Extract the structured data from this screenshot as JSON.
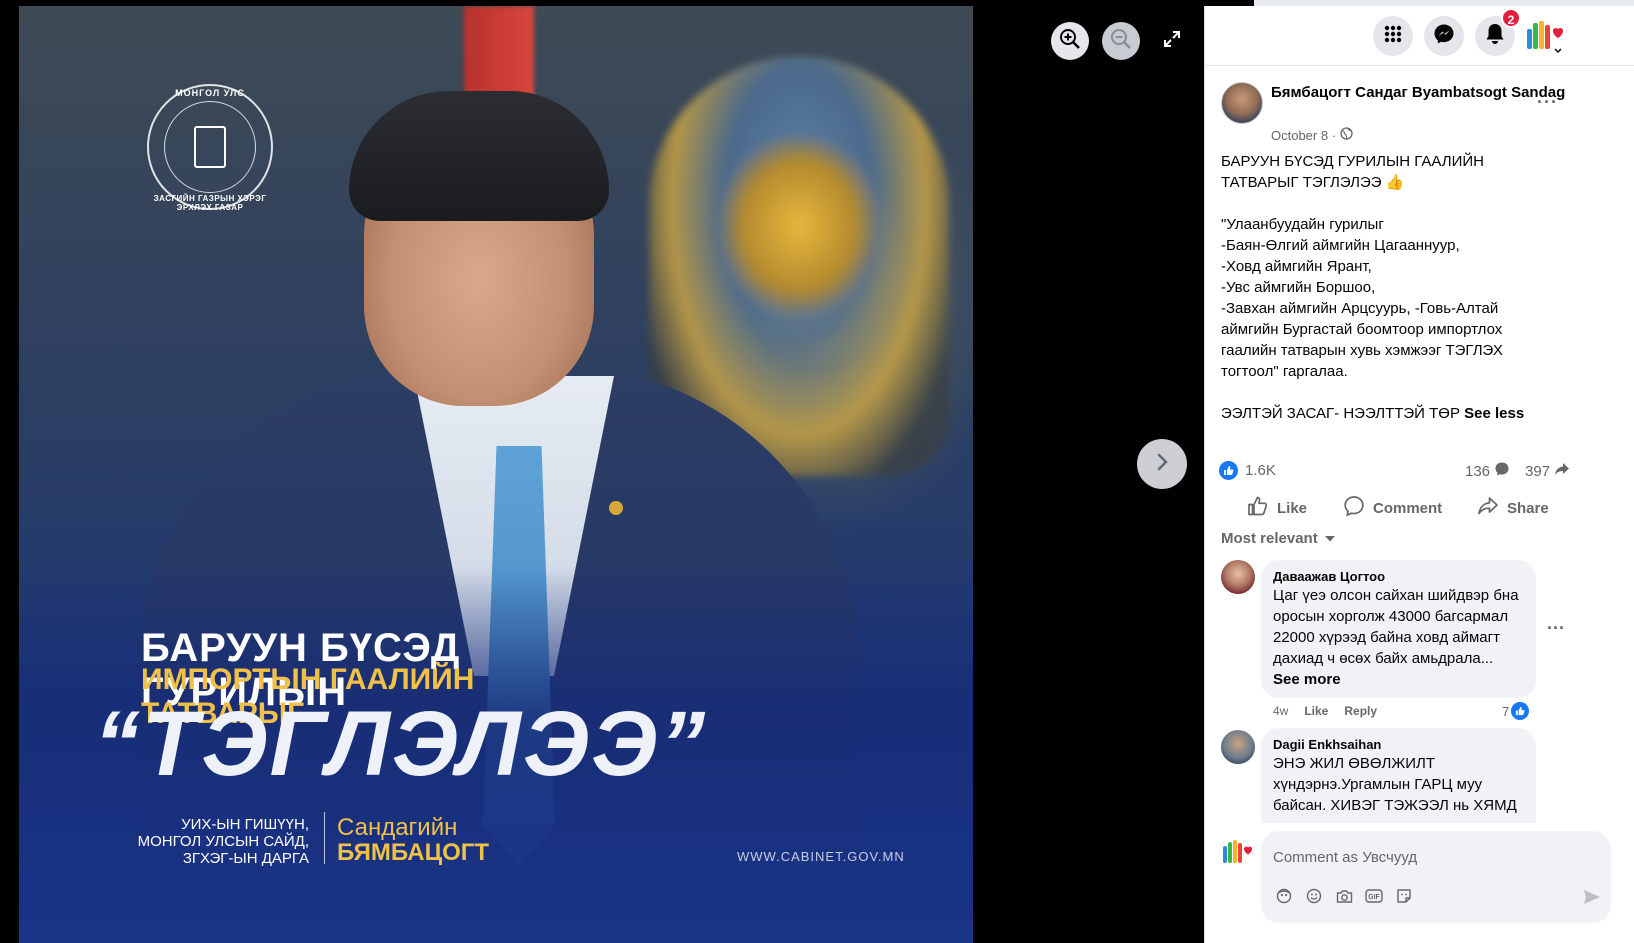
{
  "viewer": {
    "image": {
      "seal_top_text": "МОНГОЛ УЛС",
      "seal_bottom_text": "ЗАСГИЙН ГАЗРЫН ХЭРЭГ ЭРХЛЭХ ГАЗАР",
      "headline_1": "БАРУУН БҮСЭД ГУРИЛЫН",
      "headline_2": "ИМПОРТЫН ГААЛИЙН ТАТВАРЫГ",
      "headline_big": "“ТЭГЛЭЛЭЭ”",
      "role_line_1": "УИХ-ЫН ГИШҮҮН,",
      "role_line_2": "МОНГОЛ УЛСЫН САЙД,",
      "role_line_3": "ЗГХЭГ-ЫН ДАРГА",
      "name_first": "Сандагийн",
      "name_last": "БЯМБАЦОГТ",
      "website": "WWW.CABINET.GOV.MN"
    },
    "icons": {
      "zoom_in": "zoom-in-icon",
      "zoom_out": "zoom-out-icon",
      "fullscreen": "fullscreen-icon",
      "next": "chevron-right-icon"
    }
  },
  "topbar": {
    "icons": [
      "menu-grid-icon",
      "messenger-icon",
      "bell-icon",
      "account-logo-icon"
    ],
    "notification_count": "2"
  },
  "post": {
    "author": "Бямбацогт Сандаг Byambatsogt Sandag",
    "date": "October 8 ·",
    "audience_icon": "globe-icon",
    "text": "БАРУУН БҮСЭД ГУРИЛЫН ГААЛИЙН ТАТВАРЫГ ТЭГЛЭЛЭЭ 👍\n\n\"Улаанбуудайн гурилыг\n-Баян-Өлгий аймгийн Цагааннуур,\n-Ховд аймгийн Ярант,\n-Увс аймгийн Боршоо,\n-Завхан аймгийн Арцсуурь, -Говь-Алтай аймгийн Бургастай боомтоор импортлох гаалийн татварын хувь хэмжээг ТЭГЛЭХ тогтоол\" гаргалаа.\n\nЭЭЛТЭЙ ЗАСАГ- НЭЭЛТТЭЙ ТӨР ",
    "see_less": "See less",
    "likes": "1.6K",
    "comments": "136",
    "shares": "397"
  },
  "actions": {
    "like": "Like",
    "comment": "Comment",
    "share": "Share"
  },
  "sort_label": "Most relevant",
  "comments": [
    {
      "name": "Даваажав Цогтоо",
      "text": "Цаг үеэ олсон сайхан шийдвэр бна оросын хорголж 43000 багсармал 22000 хүрээд байна ховд аймагт дахиад ч өсөх байх амьдрала... ",
      "see_more": "See more",
      "age": "4w",
      "like": "Like",
      "reply": "Reply",
      "reactions": "7"
    },
    {
      "name": "Dagii Enkhsaihan",
      "text": "ЭНЭ ЖИЛ ӨВӨЛЖИЛТ хүндэрнэ.Ургамлын ГАРЦ муу байсан. ХИВЭГ ТЭЖЭЭЛ нь ХЯМД"
    }
  ],
  "compose": {
    "placeholder": "Comment as Увсчууд",
    "icons": [
      "avatar-sticker-icon",
      "emoji-icon",
      "camera-icon",
      "gif-icon",
      "sticker-icon",
      "send-icon"
    ]
  },
  "colors": {
    "accent": "#1877f2",
    "badge": "#e41e3f",
    "gold": "#f0c048",
    "muted": "#65676b"
  }
}
